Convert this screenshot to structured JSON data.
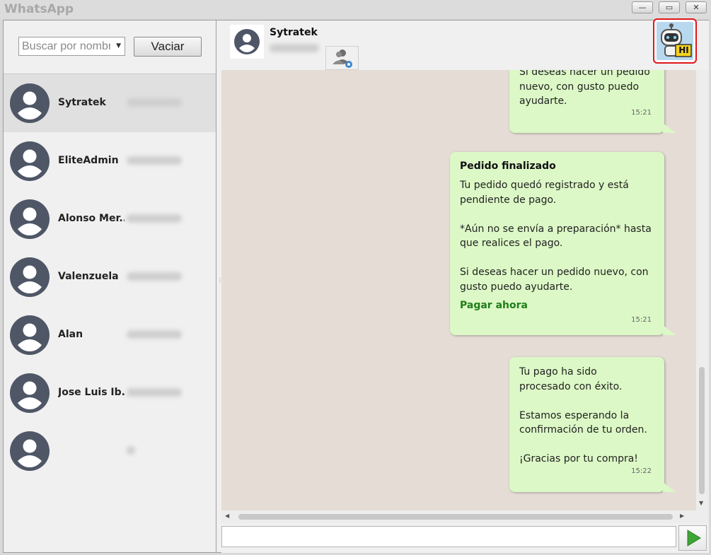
{
  "window": {
    "title": "WhatsApp",
    "min_glyph": "—",
    "max_glyph": "▭",
    "close_glyph": "✕"
  },
  "search": {
    "placeholder": "Buscar por nombre",
    "clear_label": "Vaciar"
  },
  "contacts": [
    {
      "name": "Sytratek",
      "selected": true
    },
    {
      "name": "EliteAdmin"
    },
    {
      "name": "Alonso Mer..."
    },
    {
      "name": "Valenzuela"
    },
    {
      "name": "Alan"
    },
    {
      "name": "Jose Luis Ib..."
    },
    {
      "name": ""
    }
  ],
  "chat_header": {
    "name": "Sytratek",
    "bot_badge": "HI"
  },
  "messages": [
    {
      "text": "Si deseas hacer un pedido\nnuevo, con gusto puedo\nayudarte.",
      "time": "15:21"
    },
    {
      "title": "Pedido finalizado",
      "text": "Tu pedido quedó registrado y está\npendiente de pago.\n\n*Aún no se envía a preparación* hasta\nque realices el pago.\n\nSi deseas hacer un pedido nuevo, con\ngusto puedo ayudarte.",
      "link": "Pagar ahora",
      "time": "15:21"
    },
    {
      "text": "Tu pago ha sido\nprocesado con éxito.\n\nEstamos esperando la\nconfirmación de tu orden.\n\n¡Gracias por tu compra!",
      "time": "15:22"
    }
  ],
  "composer": {
    "value": ""
  },
  "icons": {
    "send": "send-icon",
    "contact_avatar": "person-icon",
    "agent": "agent-settings-icon",
    "bot": "robot-icon"
  },
  "colors": {
    "bubble": "#dcf8c6",
    "chat_bg": "#e5ddd5",
    "link": "#1e7e18",
    "send_arrow": "#3fa535",
    "bot_highlight": "#e0161a"
  }
}
